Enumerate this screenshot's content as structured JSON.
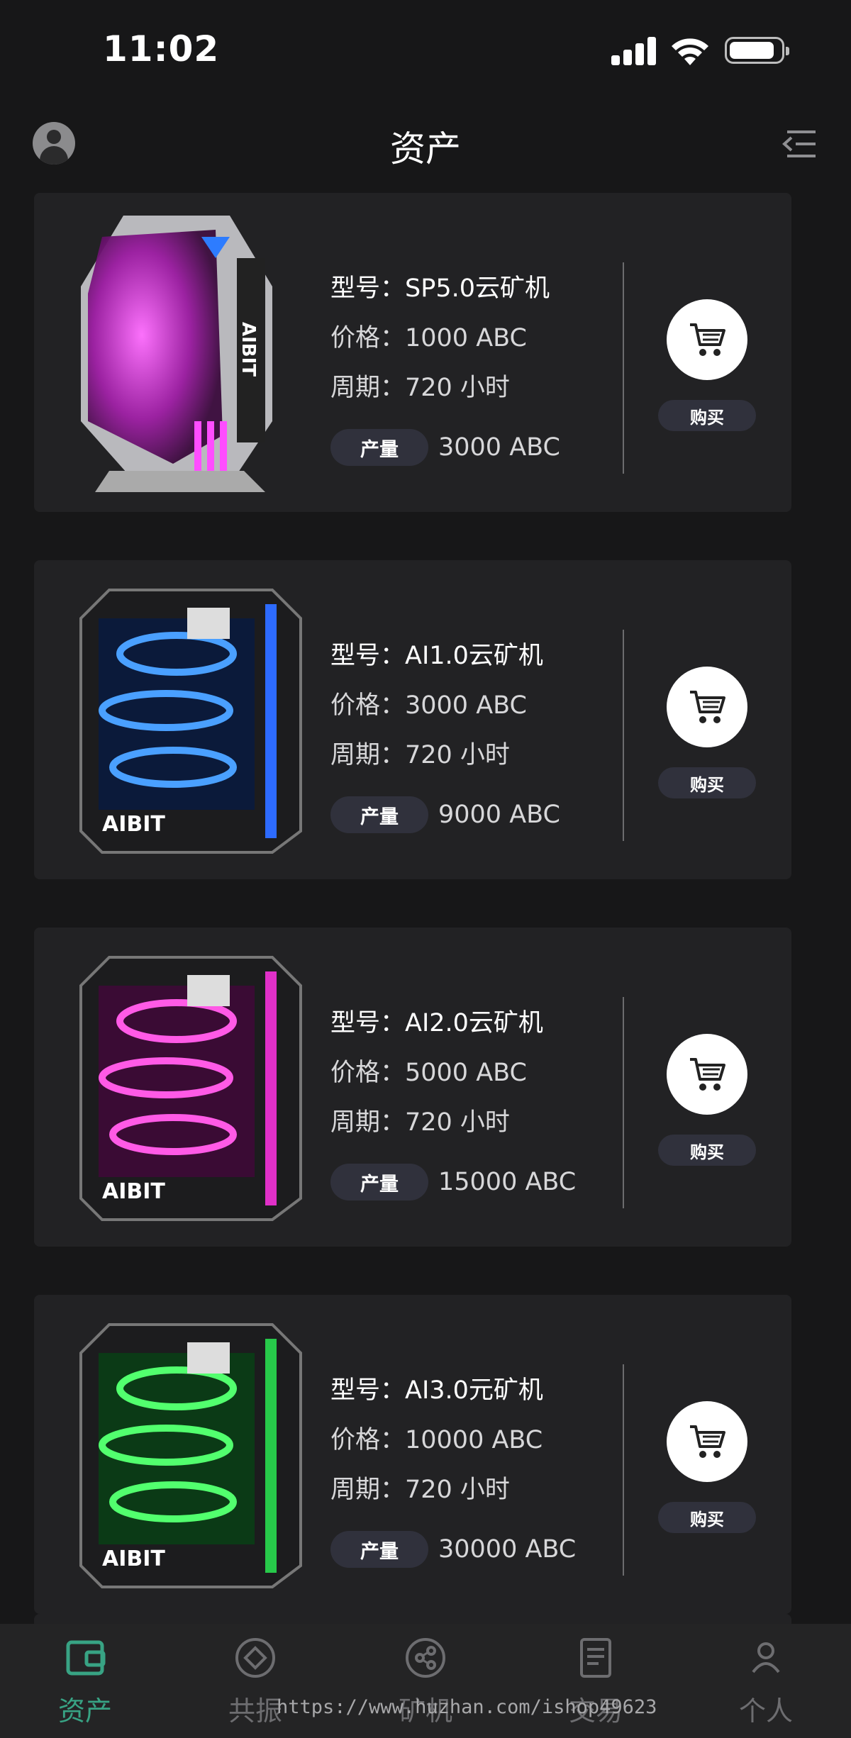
{
  "status": {
    "time": "11:02"
  },
  "nav": {
    "title": "资产"
  },
  "products": [
    {
      "model": "型号：SP5.0云矿机",
      "price": "价格：1000 ABC",
      "period": "周期：720 小时",
      "yield_label": "产量",
      "yield_value": "3000 ABC",
      "buy_label": "购买",
      "image_text": "AIBIT",
      "accent": "#d13bd6",
      "glow": "#ff4dff"
    },
    {
      "model": "型号：AI1.0云矿机",
      "price": "价格：3000 ABC",
      "period": "周期：720 小时",
      "yield_label": "产量",
      "yield_value": "9000 ABC",
      "buy_label": "购买",
      "image_text": "AIBIT",
      "accent": "#2d6bff",
      "glow": "#4aa0ff"
    },
    {
      "model": "型号：AI2.0云矿机",
      "price": "价格：5000 ABC",
      "period": "周期：720 小时",
      "yield_label": "产量",
      "yield_value": "15000 ABC",
      "buy_label": "购买",
      "image_text": "AIBIT",
      "accent": "#e030c8",
      "glow": "#ff5ae6"
    },
    {
      "model": "型号：AI3.0元矿机",
      "price": "价格：10000 ABC",
      "period": "周期：720 小时",
      "yield_label": "产量",
      "yield_value": "30000 ABC",
      "buy_label": "购买",
      "image_text": "AIBIT",
      "accent": "#27c94a",
      "glow": "#52ff6e"
    }
  ],
  "tabs": [
    {
      "label": "资产",
      "icon": "wallet-icon",
      "active": true
    },
    {
      "label": "共振",
      "icon": "diamond-circle-icon",
      "active": false
    },
    {
      "label": "矿机",
      "icon": "share-nodes-icon",
      "active": false
    },
    {
      "label": "交易",
      "icon": "document-icon",
      "active": false
    },
    {
      "label": "个人",
      "icon": "person-icon",
      "active": false
    }
  ],
  "watermark": "https://www.huzhan.com/ishop49623",
  "colors": {
    "background": "#171718",
    "card": "#222224",
    "active_tab": "#38a384",
    "badge": "#30313c"
  }
}
